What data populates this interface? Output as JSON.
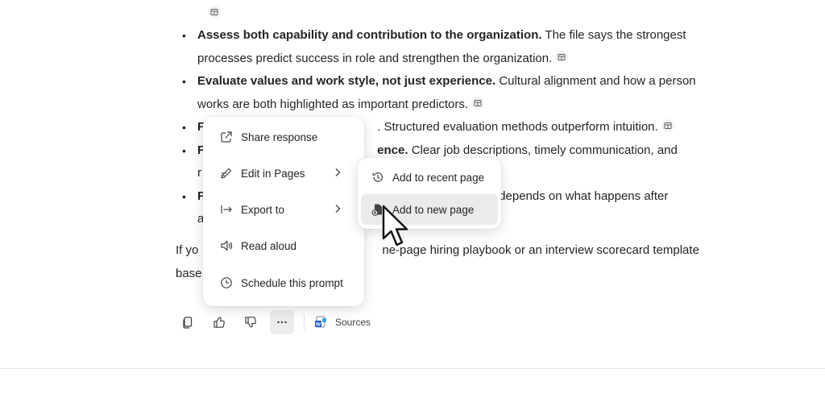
{
  "response": {
    "bullets": [
      {
        "bold": "Assess both capability and contribution to the organization.",
        "text": " The file says the strongest processes predict success in role and strengthen the organization."
      },
      {
        "bold": "Evaluate values and work style, not just experience.",
        "text": " Cultural alignment and how a person works are both highlighted as important predictors."
      },
      {
        "bold": "F",
        "text": "",
        "tail": ". Structured evaluation methods outperform intuition."
      },
      {
        "bold": "F",
        "text": "",
        "tail_bold": "ence.",
        "tail": " Clear job descriptions, timely communication, and",
        "line2": "r"
      },
      {
        "bold": "F",
        "text": "",
        "tail": "depends on what happens after",
        "line2": "a"
      }
    ],
    "closing_line1_a": "If yo",
    "closing_line1_b": "ne-page hiring playbook or an interview scorecard template",
    "closing_line2": "base"
  },
  "actions": {
    "sources_label": "Sources"
  },
  "context_menu": {
    "items": [
      {
        "label": "Share response",
        "icon": "share-icon"
      },
      {
        "label": "Edit in Pages",
        "icon": "edit-pages-icon",
        "has_submenu": true
      },
      {
        "label": "Export to",
        "icon": "export-icon",
        "has_submenu": true
      },
      {
        "label": "Read aloud",
        "icon": "speaker-icon"
      },
      {
        "label": "Schedule this prompt",
        "icon": "clock-icon"
      }
    ]
  },
  "submenu": {
    "items": [
      {
        "label": "Add to recent page",
        "icon": "history-icon"
      },
      {
        "label": "Add to new page",
        "icon": "new-page-icon",
        "hovered": true
      }
    ]
  }
}
